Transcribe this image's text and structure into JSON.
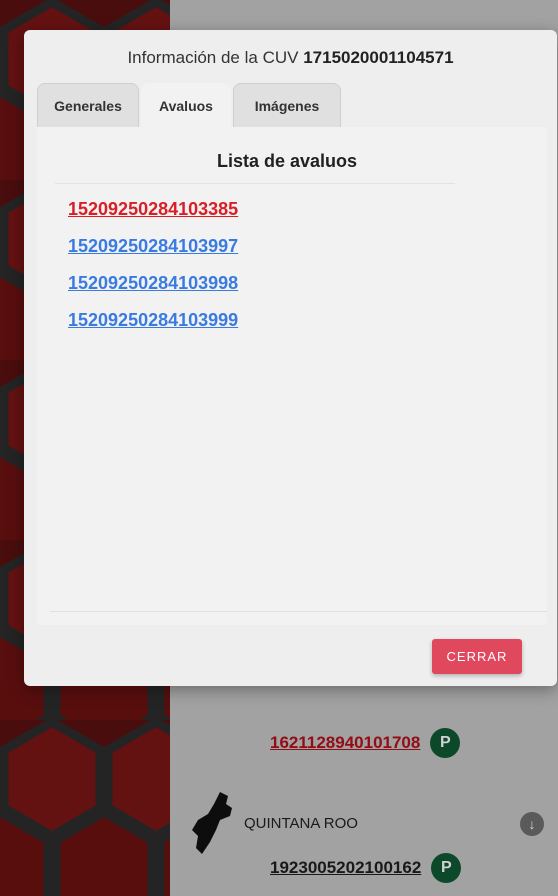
{
  "modal": {
    "title_prefix": "Información de la CUV",
    "cuv": "1715020001104571",
    "tabs": [
      {
        "label": "Generales",
        "active": false
      },
      {
        "label": "Avaluos",
        "active": true
      },
      {
        "label": "Imágenes",
        "active": false
      }
    ],
    "list_title": "Lista de avaluos",
    "appraisals": [
      {
        "id": "15209250284103385",
        "color": "#d81f26"
      },
      {
        "id": "15209250284103997",
        "color": "#3a7be0"
      },
      {
        "id": "15209250284103998",
        "color": "#3a7be0"
      },
      {
        "id": "15209250284103999",
        "color": "#3a7be0"
      }
    ],
    "close_label": "CERRAR",
    "close_color": "#e0485e"
  },
  "background": {
    "entries": [
      {
        "cuv": "1621128940101708",
        "color": "#b2111a",
        "badge": "P"
      },
      {
        "state": "QUINTANA ROO",
        "cuv": "1923005202100162",
        "color": "#1f1f1f",
        "badge": "P"
      }
    ],
    "expand_icon": "arrow-down-icon",
    "badge_color": "#0f5a34"
  }
}
